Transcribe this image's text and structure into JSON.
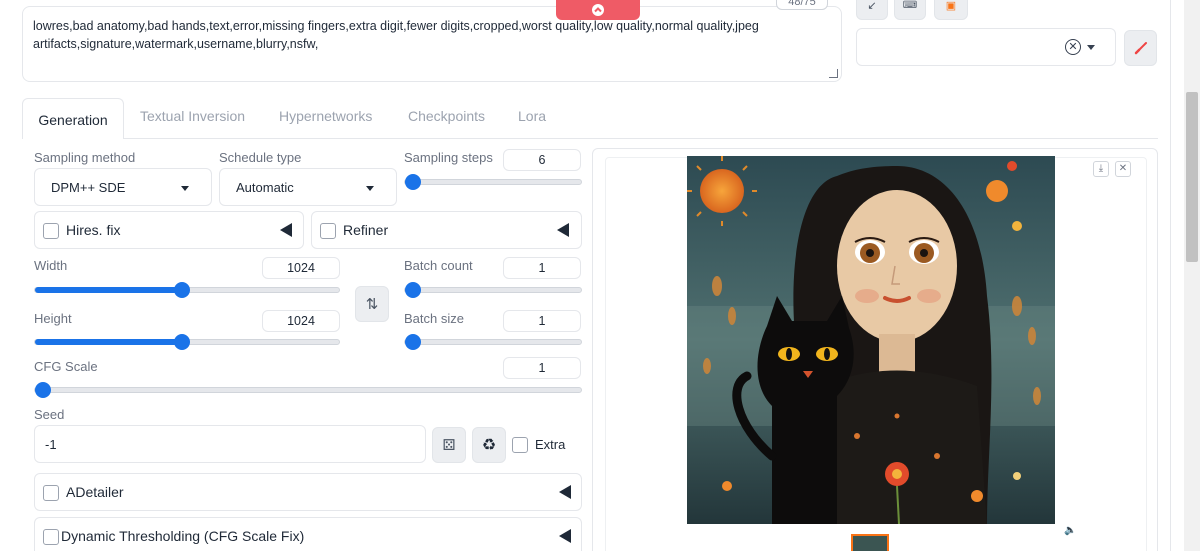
{
  "prompt": {
    "negative_text": "lowres,bad anatomy,bad hands,text,error,missing fingers,extra digit,fewer digits,cropped,worst quality,low quality,normal quality,jpeg artifacts,signature,watermark,username,blurry,nsfw,",
    "token_counter": "48/75"
  },
  "tabs": [
    "Generation",
    "Textual Inversion",
    "Hypernetworks",
    "Checkpoints",
    "Lora"
  ],
  "sampling": {
    "method_label": "Sampling method",
    "method_value": "DPM++ SDE",
    "schedule_label": "Schedule type",
    "schedule_value": "Automatic",
    "steps_label": "Sampling steps",
    "steps_value": "6",
    "steps_fraction": 0.04
  },
  "accordions": {
    "hires": "Hires. fix",
    "refiner": "Refiner",
    "adetailer": "ADetailer",
    "dynamic": "Dynamic Thresholding (CFG Scale Fix)"
  },
  "size": {
    "width_label": "Width",
    "width_value": "1024",
    "width_fraction": 0.48,
    "height_label": "Height",
    "height_value": "1024",
    "height_fraction": 0.48,
    "swap_icon": "swap-arrows-icon"
  },
  "batch": {
    "count_label": "Batch count",
    "count_value": "1",
    "size_label": "Batch size",
    "size_value": "1"
  },
  "cfg": {
    "label": "CFG Scale",
    "value": "1",
    "fraction": 0.0
  },
  "seed": {
    "label": "Seed",
    "value": "-1",
    "extra_label": "Extra"
  },
  "colors": {
    "accent": "#1a73e8",
    "generate_button": "#ef4444"
  }
}
